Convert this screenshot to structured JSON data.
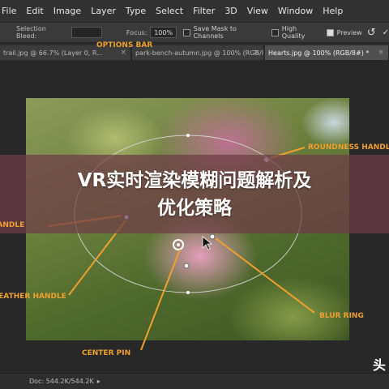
{
  "menu": {
    "items": [
      "File",
      "Edit",
      "Image",
      "Layer",
      "Type",
      "Select",
      "Filter",
      "3D",
      "View",
      "Window",
      "Help"
    ]
  },
  "options_bar": {
    "selection_bleed_label": "Selection Bleed:",
    "focus_label": "Focus:",
    "focus_value": "100%",
    "save_mask_label": "Save Mask to Channels",
    "high_quality_label": "High Quality",
    "preview_label": "Preview",
    "undo_icon": "undo-icon",
    "preview_checked": true
  },
  "tabs": [
    "trail.jpg @ 66.7% (Layer 0, R...",
    "park-bench-autumn.jpg @ 100% (RGB/8...",
    "Hearts.jpg @ 100% (RGB/8#) *"
  ],
  "callouts": {
    "options_bar": "OPTIONS BAR",
    "roundness_handle": "ROUNDNESS HANDLE",
    "feather_handle": "FEATHER HANDLE",
    "fade_handle": "FADE HANDLE",
    "center_pin": "CENTER PIN",
    "blur_ring": "BLUR RING"
  },
  "banner": {
    "line1": "VR实时渲染模糊问题解析及",
    "line2": "优化策略"
  },
  "status": {
    "doc_info": "Doc: 544.2K/544.2K"
  },
  "watermark": "头",
  "colors": {
    "callout": "#f0a030",
    "banner_bg": "#6e3c46"
  }
}
